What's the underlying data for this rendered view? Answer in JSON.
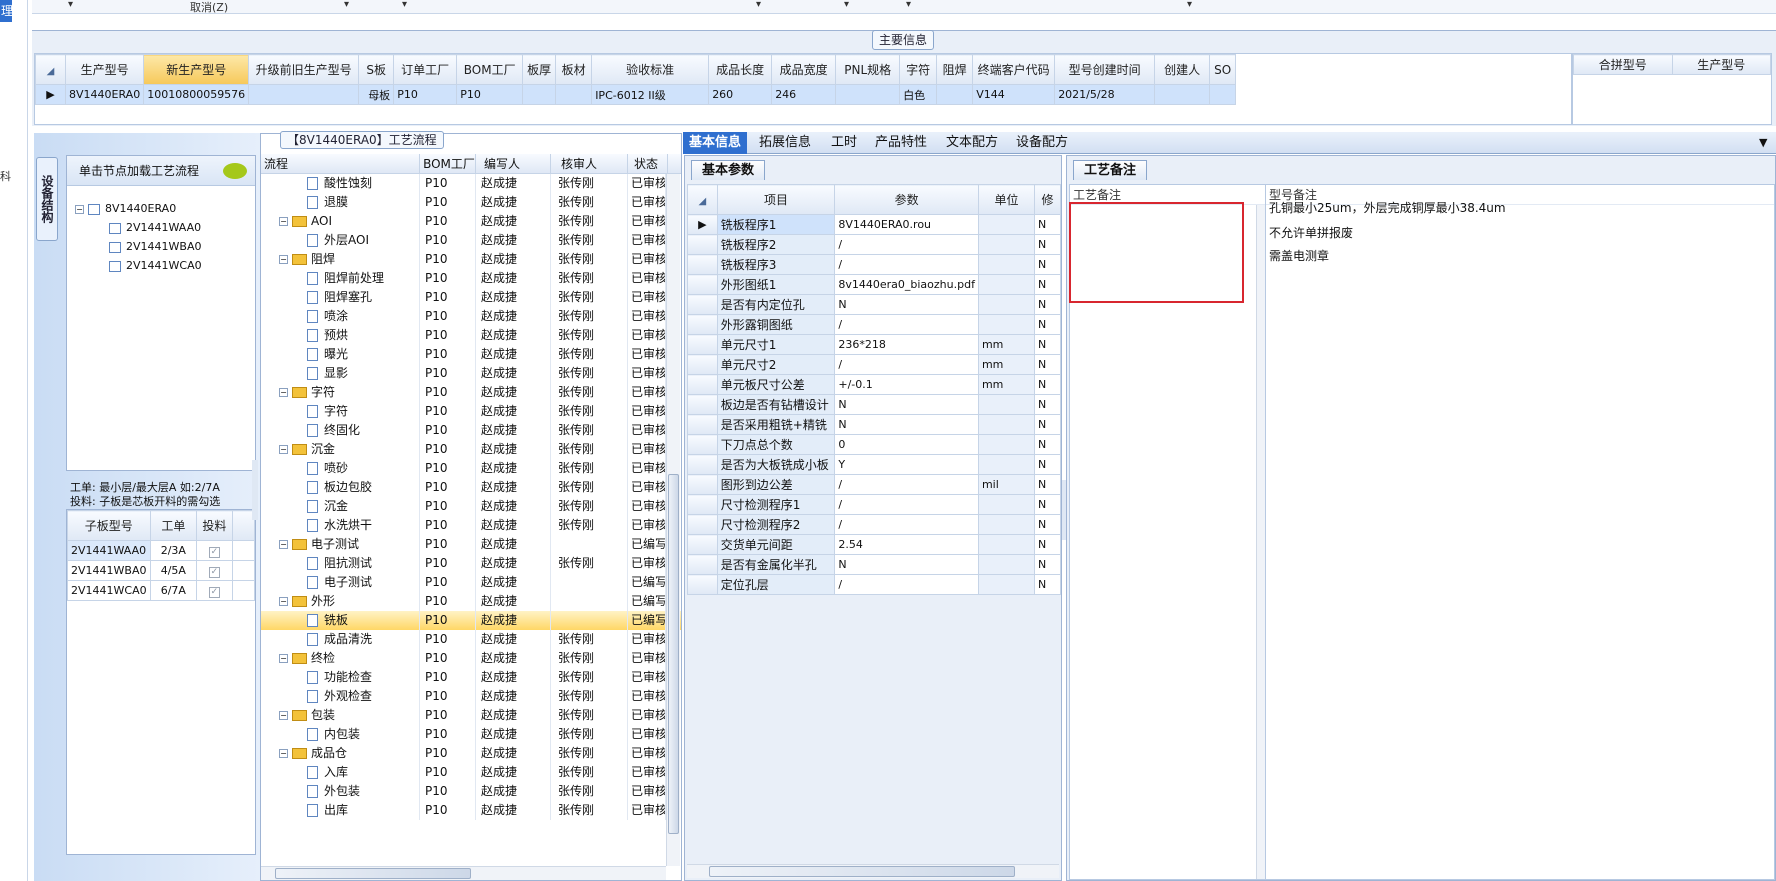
{
  "left_strip": {
    "highlight_char": "理",
    "small_char": "科"
  },
  "topbar": {
    "cancel_label": "取消(Z)"
  },
  "main_info": {
    "title": "主要信息",
    "columns": [
      "生产型号",
      "新生产型号",
      "升级前旧生产型号",
      "S板",
      "订单工厂",
      "BOM工厂",
      "板厚",
      "板材",
      "验收标准",
      "成品长度",
      "成品宽度",
      "PNL规格",
      "字符",
      "阻焊",
      "终端客户代码",
      "型号创建时间",
      "创建人",
      "SO"
    ],
    "row": [
      "8V1440ERA0",
      "10010800059576",
      "",
      "母板",
      "P10",
      "P10",
      "",
      "",
      "IPC-6012 II级",
      "260",
      "246",
      "",
      "白色",
      "",
      "V144",
      "2021/5/28",
      "",
      ""
    ],
    "right_columns": [
      "合拼型号",
      "生产型号"
    ]
  },
  "left_panel": {
    "vertical_tab": "设备结构",
    "tree_header": "单击节点加载工艺流程",
    "tree": [
      {
        "label": "8V1440ERA0",
        "level": 0
      },
      {
        "label": "2V1441WAA0",
        "level": 1
      },
      {
        "label": "2V1441WBA0",
        "level": 1
      },
      {
        "label": "2V1441WCA0",
        "level": 1
      }
    ],
    "note_line1": "工单: 最小层/最大层A 如:2/7A",
    "note_line2": "投料: 子板是芯板开料的需勾选",
    "sub_columns": [
      "子板型号",
      "工单",
      "投料"
    ],
    "sub_rows": [
      {
        "model": "2V1441WAA0",
        "order": "2/3A",
        "feed": true
      },
      {
        "model": "2V1441WBA0",
        "order": "4/5A",
        "feed": true
      },
      {
        "model": "2V1441WCA0",
        "order": "6/7A",
        "feed": true
      }
    ]
  },
  "flow_panel": {
    "title": "【8V1440ERA0】工艺流程",
    "columns": [
      "流程",
      "BOM工厂",
      "编写人",
      "核审人",
      "状态"
    ],
    "rows": [
      {
        "type": "leaf",
        "name": "酸性蚀刻",
        "bom": "P10",
        "writer": "赵成捷",
        "reviewer": "张传刚",
        "status": "已审核"
      },
      {
        "type": "leaf",
        "name": "退膜",
        "bom": "P10",
        "writer": "赵成捷",
        "reviewer": "张传刚",
        "status": "已审核"
      },
      {
        "type": "group",
        "name": "AOI",
        "bom": "P10",
        "writer": "赵成捷",
        "reviewer": "张传刚",
        "status": "已审核"
      },
      {
        "type": "leaf",
        "name": "外层AOI",
        "bom": "P10",
        "writer": "赵成捷",
        "reviewer": "张传刚",
        "status": "已审核"
      },
      {
        "type": "group",
        "name": "阻焊",
        "bom": "P10",
        "writer": "赵成捷",
        "reviewer": "张传刚",
        "status": "已审核"
      },
      {
        "type": "leaf",
        "name": "阻焊前处理",
        "bom": "P10",
        "writer": "赵成捷",
        "reviewer": "张传刚",
        "status": "已审核"
      },
      {
        "type": "leaf",
        "name": "阻焊塞孔",
        "bom": "P10",
        "writer": "赵成捷",
        "reviewer": "张传刚",
        "status": "已审核"
      },
      {
        "type": "leaf",
        "name": "喷涂",
        "bom": "P10",
        "writer": "赵成捷",
        "reviewer": "张传刚",
        "status": "已审核"
      },
      {
        "type": "leaf",
        "name": "预烘",
        "bom": "P10",
        "writer": "赵成捷",
        "reviewer": "张传刚",
        "status": "已审核"
      },
      {
        "type": "leaf",
        "name": "曝光",
        "bom": "P10",
        "writer": "赵成捷",
        "reviewer": "张传刚",
        "status": "已审核"
      },
      {
        "type": "leaf",
        "name": "显影",
        "bom": "P10",
        "writer": "赵成捷",
        "reviewer": "张传刚",
        "status": "已审核"
      },
      {
        "type": "group",
        "name": "字符",
        "bom": "P10",
        "writer": "赵成捷",
        "reviewer": "张传刚",
        "status": "已审核"
      },
      {
        "type": "leaf",
        "name": "字符",
        "bom": "P10",
        "writer": "赵成捷",
        "reviewer": "张传刚",
        "status": "已审核"
      },
      {
        "type": "leaf",
        "name": "终固化",
        "bom": "P10",
        "writer": "赵成捷",
        "reviewer": "张传刚",
        "status": "已审核"
      },
      {
        "type": "group",
        "name": "沉金",
        "bom": "P10",
        "writer": "赵成捷",
        "reviewer": "张传刚",
        "status": "已审核"
      },
      {
        "type": "leaf",
        "name": "喷砂",
        "bom": "P10",
        "writer": "赵成捷",
        "reviewer": "张传刚",
        "status": "已审核"
      },
      {
        "type": "leaf",
        "name": "板边包胶",
        "bom": "P10",
        "writer": "赵成捷",
        "reviewer": "张传刚",
        "status": "已审核"
      },
      {
        "type": "leaf",
        "name": "沉金",
        "bom": "P10",
        "writer": "赵成捷",
        "reviewer": "张传刚",
        "status": "已审核"
      },
      {
        "type": "leaf",
        "name": "水洗烘干",
        "bom": "P10",
        "writer": "赵成捷",
        "reviewer": "张传刚",
        "status": "已审核"
      },
      {
        "type": "group",
        "name": "电子测试",
        "bom": "P10",
        "writer": "赵成捷",
        "reviewer": "",
        "status": "已编写"
      },
      {
        "type": "leaf",
        "name": "阻抗测试",
        "bom": "P10",
        "writer": "赵成捷",
        "reviewer": "张传刚",
        "status": "已审核"
      },
      {
        "type": "leaf",
        "name": "电子测试",
        "bom": "P10",
        "writer": "赵成捷",
        "reviewer": "",
        "status": "已编写"
      },
      {
        "type": "group",
        "name": "外形",
        "bom": "P10",
        "writer": "赵成捷",
        "reviewer": "",
        "status": "已编写"
      },
      {
        "type": "leaf",
        "name": "铣板",
        "bom": "P10",
        "writer": "赵成捷",
        "reviewer": "",
        "status": "已编写",
        "selected": true
      },
      {
        "type": "leaf",
        "name": "成品清洗",
        "bom": "P10",
        "writer": "赵成捷",
        "reviewer": "张传刚",
        "status": "已审核"
      },
      {
        "type": "group",
        "name": "终检",
        "bom": "P10",
        "writer": "赵成捷",
        "reviewer": "张传刚",
        "status": "已审核"
      },
      {
        "type": "leaf",
        "name": "功能检查",
        "bom": "P10",
        "writer": "赵成捷",
        "reviewer": "张传刚",
        "status": "已审核"
      },
      {
        "type": "leaf",
        "name": "外观检查",
        "bom": "P10",
        "writer": "赵成捷",
        "reviewer": "张传刚",
        "status": "已审核"
      },
      {
        "type": "group",
        "name": "包装",
        "bom": "P10",
        "writer": "赵成捷",
        "reviewer": "张传刚",
        "status": "已审核"
      },
      {
        "type": "leaf",
        "name": "内包装",
        "bom": "P10",
        "writer": "赵成捷",
        "reviewer": "张传刚",
        "status": "已审核"
      },
      {
        "type": "group",
        "name": "成品仓",
        "bom": "P10",
        "writer": "赵成捷",
        "reviewer": "张传刚",
        "status": "已审核"
      },
      {
        "type": "leaf",
        "name": "入库",
        "bom": "P10",
        "writer": "赵成捷",
        "reviewer": "张传刚",
        "status": "已审核"
      },
      {
        "type": "leaf",
        "name": "外包装",
        "bom": "P10",
        "writer": "赵成捷",
        "reviewer": "张传刚",
        "status": "已审核"
      },
      {
        "type": "leaf",
        "name": "出库",
        "bom": "P10",
        "writer": "赵成捷",
        "reviewer": "张传刚",
        "status": "已审核"
      }
    ]
  },
  "tabs": [
    "基本信息",
    "拓展信息",
    "工时",
    "产品特性",
    "文本配方",
    "设备配方"
  ],
  "basic_params": {
    "subtab": "基本参数",
    "columns": [
      "项目",
      "参数",
      "单位",
      "修"
    ],
    "rows": [
      {
        "item": "铣板程序1",
        "value": "8V1440ERA0.rou",
        "unit": "",
        "mod": "N"
      },
      {
        "item": "铣板程序2",
        "value": "/",
        "unit": "",
        "mod": "N"
      },
      {
        "item": "铣板程序3",
        "value": "/",
        "unit": "",
        "mod": "N"
      },
      {
        "item": "外形图纸1",
        "value": "8v1440era0_biaozhu.pdf",
        "unit": "",
        "mod": "N"
      },
      {
        "item": "是否有内定位孔",
        "value": "N",
        "unit": "",
        "mod": "N"
      },
      {
        "item": "外形露铜图纸",
        "value": "/",
        "unit": "",
        "mod": "N"
      },
      {
        "item": "单元尺寸1",
        "value": "236*218",
        "unit": "mm",
        "mod": "N"
      },
      {
        "item": "单元尺寸2",
        "value": "/",
        "unit": "mm",
        "mod": "N"
      },
      {
        "item": "单元板尺寸公差",
        "value": "+/-0.1",
        "unit": "mm",
        "mod": "N"
      },
      {
        "item": "板边是否有钻槽设计",
        "value": "N",
        "unit": "",
        "mod": "N"
      },
      {
        "item": "是否采用粗铣+精铣",
        "value": "N",
        "unit": "",
        "mod": "N"
      },
      {
        "item": "下刀点总个数",
        "value": "0",
        "unit": "",
        "mod": "N"
      },
      {
        "item": "是否为大板铣成小板",
        "value": "Y",
        "unit": "",
        "mod": "N"
      },
      {
        "item": "图形到边公差",
        "value": "/",
        "unit": "mil",
        "mod": "N"
      },
      {
        "item": "尺寸检测程序1",
        "value": "/",
        "unit": "",
        "mod": "N"
      },
      {
        "item": "尺寸检测程序2",
        "value": "/",
        "unit": "",
        "mod": "N"
      },
      {
        "item": "交货单元间距",
        "value": "2.54",
        "unit": "",
        "mod": "N"
      },
      {
        "item": "是否有金属化半孔",
        "value": "N",
        "unit": "",
        "mod": "N"
      },
      {
        "item": "定位孔层",
        "value": "/",
        "unit": "",
        "mod": "N"
      }
    ]
  },
  "remarks": {
    "subtab": "工艺备注",
    "process_label": "工艺备注",
    "model_label": "型号备注",
    "model_lines": [
      "孔铜最小25um，外层完成铜厚最小38.4um",
      "不允许单拼报废",
      "需盖电测章"
    ]
  }
}
